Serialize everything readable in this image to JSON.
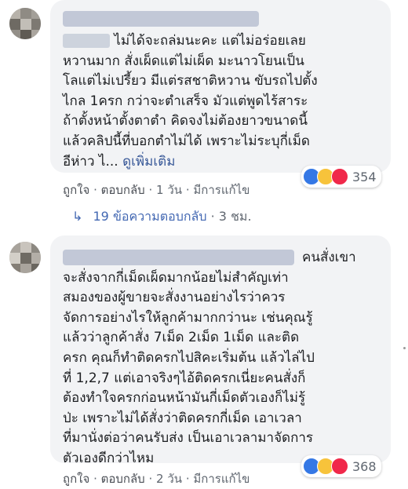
{
  "comments": [
    {
      "text": "ไม่ได้จะถล่มนะคะ แต่ไม่อร่อยเลย\nหวานมาก สั่งเผ็ดแต่ไม่เผ็ด มะนาวโยนเป็น\nโลแต่ไม่เปรี้ยว มีแต่รสชาติหวาน ขับรถไปตั้ง\nไกล 1ครก กว่าจะตำเสร็จ มัวแต่พูดไร้สาระ\nถ้าตั้งหน้าตั้งตาตำ คิดจงไม่ต้องยาวขนาดนี้\nแล้วคลิปนี้ที่บอกตำไม่ได้ เพราะไม่ระบุกี่เม็ด\nอีห่าว ไ... ",
      "see_more": "ดูเพิ่มเติม",
      "reaction_count": "354",
      "like": "ถูกใจ",
      "reply": "ตอบกลับ",
      "time": "1 วัน",
      "edited": "มีการแก้ไข"
    },
    {
      "text": "คนสั่งเขา\nจะสั่งจากกี่เม็ดเผ็ดมากน้อยไม่สำคัญเท่า\nสมองของผู้ขายจะสั่งงานอย่างไรว่าควร\nจัดการอย่างไรให้ลูกค้ามากกว่านะ เช่นคุณรู้\nแล้วว่าลูกค้าสั่ง 7เม็ด 2เม็ด 1เม็ด และติด\nครก คุณก็ทำติดครกไปสิคะเริ่มต้น แล้วไล่ไป\nที่ 1,2,7 แต่เอาจริงๆไอ้ติดครกเนี่ยะคนสั่งก็\nต้องทำใจครกก่อนหน้ามันกี่เม็ดตัวเองก็ไม่รู้\nป่ะ เพราะไม่ได้สั่งว่าติดครกกี่เม็ด เอาเวลา\nที่มานั่งต่อว่าคนรับส่ง เป็นเอาเวลามาจัดการ\nตัวเองดีกว่าไหม",
      "reaction_count": "368",
      "like": "ถูกใจ",
      "reply": "ตอบกลับ",
      "time": "2 วัน",
      "edited": "มีการแก้ไข"
    }
  ],
  "reply_thread": {
    "count_label": "19 ข้อความตอบกลับ",
    "time": "3 ชม."
  },
  "separator": "·",
  "colors": {
    "bubble": "#f2f3f5",
    "link": "#385898",
    "reply_link": "#4267b2",
    "meta": "#606770"
  }
}
